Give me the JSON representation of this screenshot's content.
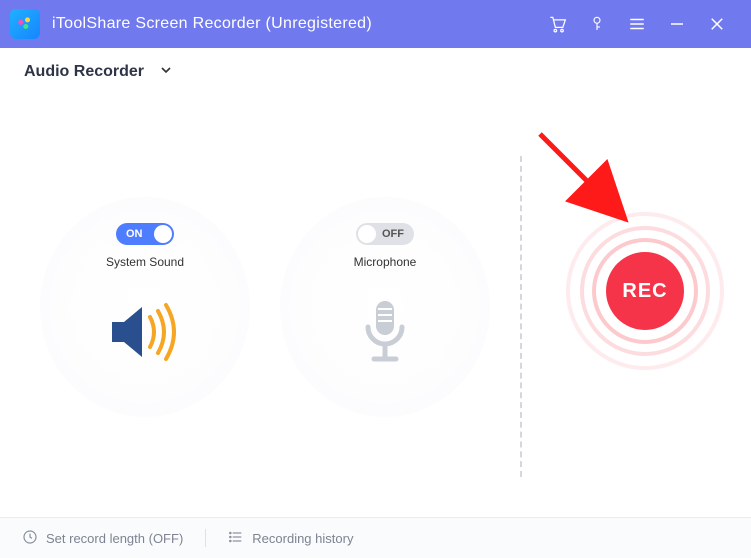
{
  "title": "iToolShare Screen Recorder (Unregistered)",
  "mode": {
    "label": "Audio Recorder"
  },
  "panels": {
    "system_sound": {
      "label": "System Sound",
      "toggle_text": "ON",
      "state": "on"
    },
    "microphone": {
      "label": "Microphone",
      "toggle_text": "OFF",
      "state": "off"
    }
  },
  "rec": {
    "label": "REC"
  },
  "footer": {
    "record_length": "Set record length (OFF)",
    "history": "Recording history"
  },
  "colors": {
    "accent": "#7079ee",
    "toggle_on": "#4f7dff",
    "rec": "#f63449",
    "speaker": "#2a4f8f",
    "wave": "#f5a623",
    "mic": "#c9cdd6"
  }
}
